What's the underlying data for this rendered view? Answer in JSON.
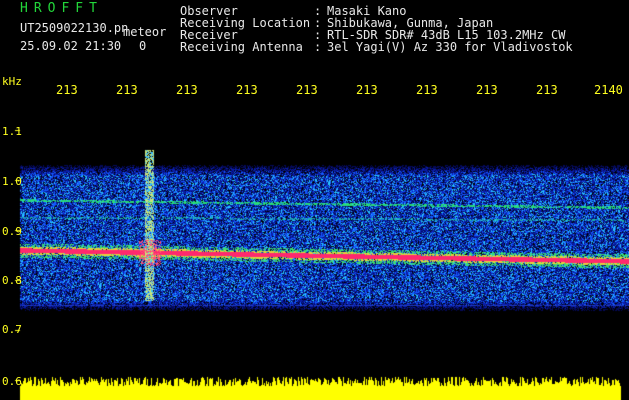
{
  "header": {
    "logo": "HROFFT",
    "filename": "UT2509022130.pn",
    "datetime": "25.09.02 21:30",
    "counter": "0",
    "event_tag": "meteor",
    "fields": [
      {
        "label": "Observer",
        "value": "Masaki Kano"
      },
      {
        "label": "Receiving Location",
        "value": "Shibukawa, Gunma, Japan"
      },
      {
        "label": "Receiver",
        "value": "RTL-SDR SDR# 43dB L15 103.2MHz CW"
      },
      {
        "label": "Receiving Antenna",
        "value": "3el Yagi(V) Az 330 for Vladivostok"
      }
    ]
  },
  "axis": {
    "unit": "kHz",
    "x_ticks": [
      "213",
      "213",
      "213",
      "213",
      "213",
      "213",
      "213",
      "213",
      "213",
      "2140"
    ],
    "y_ticks": [
      "1.1",
      "1.0",
      "0.9",
      "0.8",
      "0.7",
      "0.6"
    ]
  },
  "colors": {
    "background": "#000000",
    "label_text": "#ffff20",
    "logo": "#22d63a",
    "noise_low": "#0a1a8a",
    "noise_mid": "#2a6cff",
    "signal_band": "#ff2a6a",
    "amplitude_trace": "#ffff00"
  }
}
